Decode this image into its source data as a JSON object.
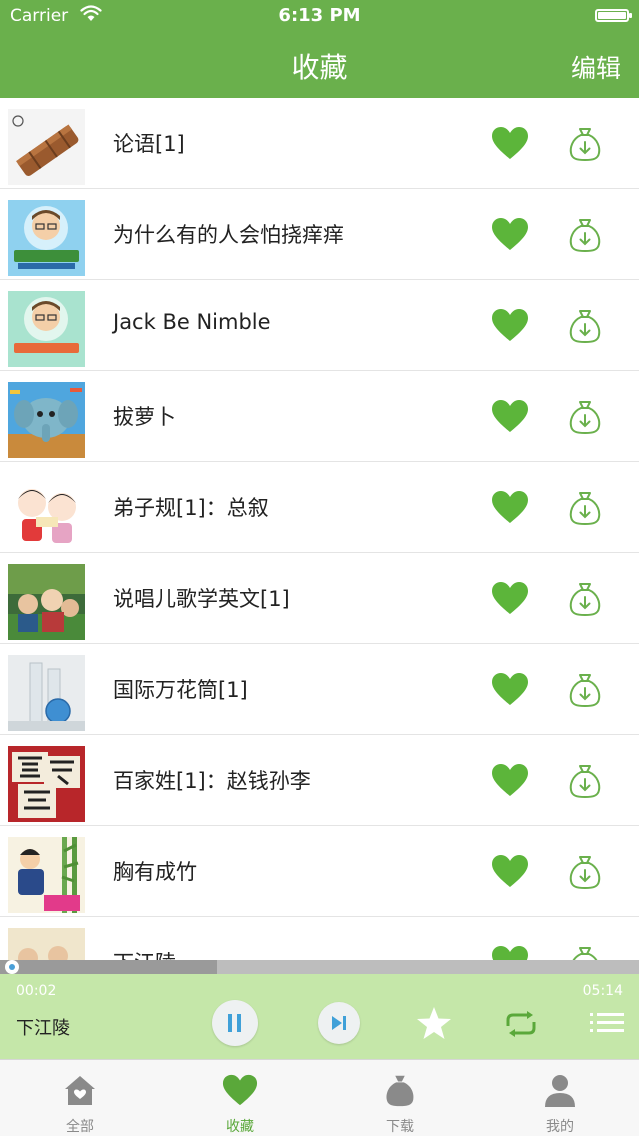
{
  "status_bar": {
    "carrier": "Carrier",
    "time": "6:13 PM"
  },
  "nav": {
    "title": "收藏",
    "edit_label": "编辑"
  },
  "list": {
    "items": [
      {
        "title": "论语[1]"
      },
      {
        "title": "为什么有的人会怕挠痒痒"
      },
      {
        "title": "Jack Be Nimble"
      },
      {
        "title": "拔萝卜"
      },
      {
        "title": "弟子规[1]：总叙"
      },
      {
        "title": "说唱儿歌学英文[1]"
      },
      {
        "title": "国际万花筒[1]"
      },
      {
        "title": "百家姓[1]：赵钱孙李"
      },
      {
        "title": "胸有成竹"
      },
      {
        "title": "下江陵"
      }
    ]
  },
  "player": {
    "current_time": "00:02",
    "total_time": "05:14",
    "song_title": "下江陵",
    "progress": 0.34
  },
  "tab_bar": {
    "tabs": [
      {
        "label": "全部",
        "icon": "home-icon"
      },
      {
        "label": "收藏",
        "icon": "heart-icon"
      },
      {
        "label": "下载",
        "icon": "download-bag-icon"
      },
      {
        "label": "我的",
        "icon": "person-icon"
      }
    ],
    "active_index": 1
  },
  "colors": {
    "accent": "#6ab04c",
    "player_bg": "#c5e7a9",
    "heart": "#5cb53a"
  }
}
